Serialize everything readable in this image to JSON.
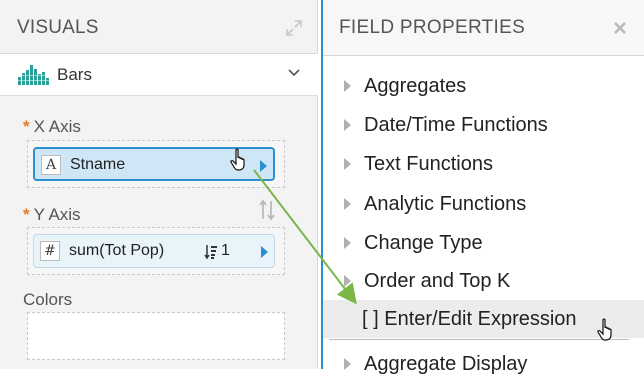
{
  "visuals_panel": {
    "title": "VISUALS",
    "chart_type": {
      "label": "Bars",
      "icon": "bar-chart-icon"
    },
    "shelves": [
      {
        "label": "X Axis",
        "required": "*",
        "pill": {
          "type_badge": "A",
          "text": "Stname",
          "selected": true
        }
      },
      {
        "label": "Y Axis",
        "required": "*",
        "pill": {
          "type_badge": "#",
          "text": "sum(Tot Pop)",
          "sort_badge": "1",
          "selected": false
        }
      },
      {
        "label": "Colors"
      }
    ]
  },
  "field_properties": {
    "title": "FIELD PROPERTIES",
    "close_label": "×",
    "items": [
      {
        "label": "Aggregates"
      },
      {
        "label": "Date/Time Functions"
      },
      {
        "label": "Text Functions"
      },
      {
        "label": "Analytic Functions"
      },
      {
        "label": "Change Type"
      },
      {
        "label": "Order and Top K"
      },
      {
        "label": "[ ] Enter/Edit Expression",
        "highlighted": true
      },
      {
        "label": "Aggregate Display"
      }
    ]
  },
  "colors": {
    "accent_blue": "#2b8fd0",
    "required_orange": "#e07a1e",
    "drag_arrow_green": "#7ab648"
  }
}
